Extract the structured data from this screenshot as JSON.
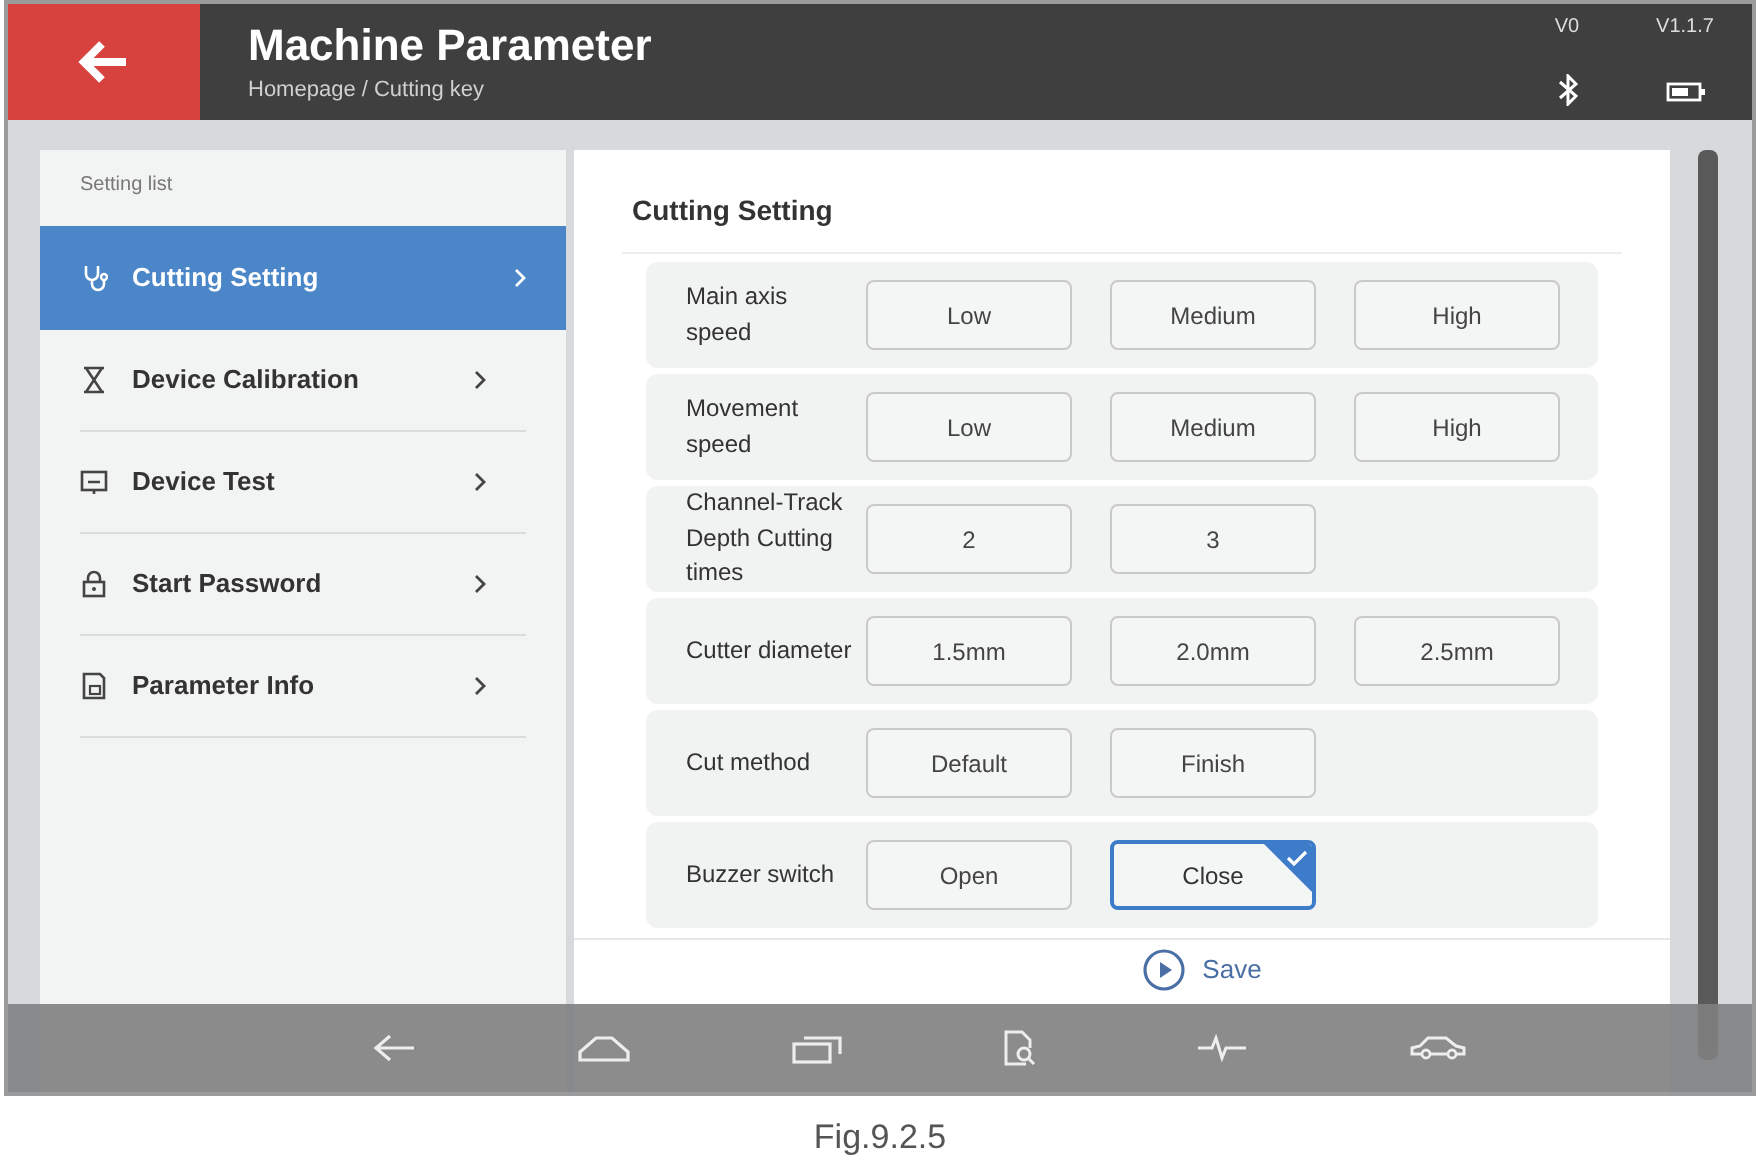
{
  "header": {
    "title": "Machine Parameter",
    "breadcrumb": "Homepage / Cutting key",
    "version_left": "V0",
    "version_right": "V1.1.7"
  },
  "sidebar": {
    "title": "Setting list",
    "items": [
      {
        "label": "Cutting Setting",
        "selected": true
      },
      {
        "label": "Device Calibration",
        "selected": false
      },
      {
        "label": "Device Test",
        "selected": false
      },
      {
        "label": "Start Password",
        "selected": false
      },
      {
        "label": "Parameter Info",
        "selected": false
      }
    ]
  },
  "panel": {
    "title": "Cutting Setting",
    "rows": [
      {
        "label": "Main axis speed",
        "options": [
          {
            "label": "Low",
            "selected": false
          },
          {
            "label": "Medium",
            "selected": false
          },
          {
            "label": "High",
            "selected": false
          }
        ]
      },
      {
        "label": "Movement speed",
        "options": [
          {
            "label": "Low",
            "selected": false
          },
          {
            "label": "Medium",
            "selected": false
          },
          {
            "label": "High",
            "selected": false
          }
        ]
      },
      {
        "label": "Channel-Track Depth Cutting times",
        "options": [
          {
            "label": "2",
            "selected": false
          },
          {
            "label": "3",
            "selected": false
          }
        ]
      },
      {
        "label": "Cutter diameter",
        "options": [
          {
            "label": "1.5mm",
            "selected": false
          },
          {
            "label": "2.0mm",
            "selected": false
          },
          {
            "label": "2.5mm",
            "selected": false
          }
        ]
      },
      {
        "label": "Cut method",
        "options": [
          {
            "label": "Default",
            "selected": false
          },
          {
            "label": "Finish",
            "selected": false
          }
        ]
      },
      {
        "label": "Buzzer switch",
        "options": [
          {
            "label": "Open",
            "selected": false
          },
          {
            "label": "Close",
            "selected": true
          }
        ]
      }
    ],
    "save_button": "Save"
  },
  "caption": "Fig.9.2.5"
}
